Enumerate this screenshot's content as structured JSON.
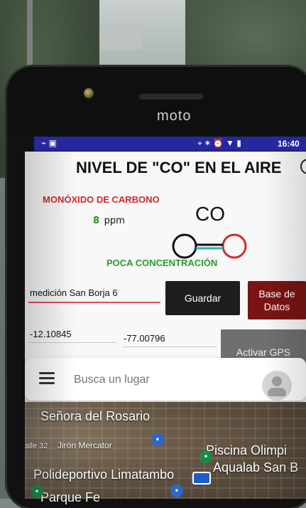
{
  "device": {
    "brand": "moto"
  },
  "status_bar": {
    "time": "16:40",
    "left_icons": "⌁ ▣",
    "right_icons": "⌖ ✶ ⏰ ▼ ▮"
  },
  "app": {
    "title": "NIVEL DE \"CO\" EN EL AIRE",
    "subtitle": "MONÓXIDO DE CARBONO",
    "gas_symbol": "CO",
    "ppm_value": "8",
    "ppm_unit": "ppm",
    "concentration_label": "POCA CONCENTRACIÓN",
    "name_input_value": "medición San Borja 6",
    "save_label": "Guardar",
    "database_label_line1": "Base de",
    "database_label_line2": "Datos",
    "latitude": "-12.10845",
    "longitude": "-77.00796",
    "gps_label": "Activar GPS",
    "search_placeholder": "Busca un lugar"
  },
  "map_labels": {
    "l1": "Señora del Rosario",
    "l2": "alle 32",
    "l3": "Jirón Mercator",
    "l4": "Polideportivo Limatambo",
    "l5": "Piscina Olimpi",
    "l6": "Aqualab San B",
    "l7": "Parque Fe"
  },
  "colors": {
    "status_bar": "#2727a0",
    "subtitle_red": "#d12a2a",
    "ok_green": "#2a9a2a",
    "save_button": "#1f1d1c",
    "db_button": "#7a1414",
    "gps_button": "#6f6f6f",
    "input_underline": "#e64c6b"
  },
  "icons": {
    "close": "close-icon",
    "menu": "menu-icon",
    "avatar": "avatar-icon"
  }
}
